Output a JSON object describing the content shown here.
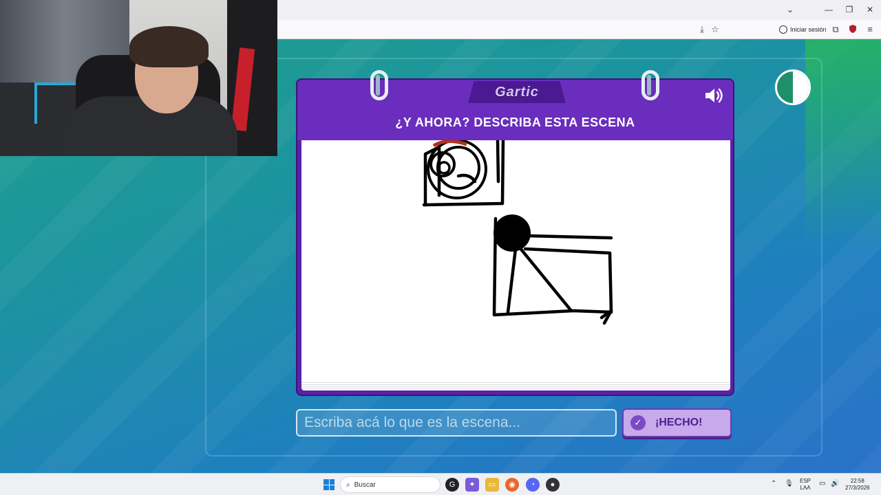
{
  "browser": {
    "signin_label": "Iniciar sesión",
    "minimize": "—",
    "restore": "❐",
    "close": "✕",
    "dropdown": "⌄"
  },
  "game": {
    "logo": "Gartic",
    "title": "¿Y AHORA? DESCRIBA ESTA ESCENA",
    "sound_icon": "speaker-icon",
    "input_placeholder": "Escriba acá lo que es la escena...",
    "input_value": "",
    "done_label": "¡HECHO!",
    "timer_fraction": 0.5
  },
  "taskbar": {
    "search_placeholder": "Buscar",
    "lang_top": "ESP",
    "lang_bottom": "LAA",
    "time": "22:58",
    "date": "27/3/2026",
    "apps": [
      "edge-icon",
      "gartic-icon",
      "copilot-icon",
      "folder-icon",
      "firefox-icon",
      "discord-icon",
      "obs-icon"
    ]
  },
  "colors": {
    "panel": "#6a2dbd",
    "accent_button": "#c7a9ec",
    "background_start": "#1fa08a",
    "background_end": "#2a72c8"
  }
}
